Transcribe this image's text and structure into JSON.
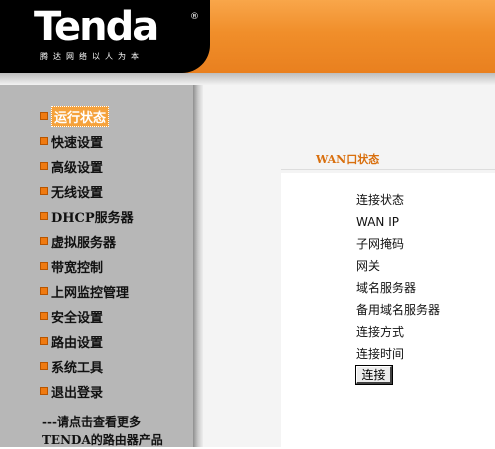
{
  "brand": {
    "logo_text": "Tenda",
    "registered_mark": "®",
    "slogan": "腾达网络以人为本"
  },
  "sidebar": {
    "items": [
      {
        "label": "运行状态",
        "active": true
      },
      {
        "label": "快速设置"
      },
      {
        "label": "高级设置"
      },
      {
        "label": "无线设置"
      },
      {
        "label": "DHCP服务器"
      },
      {
        "label": "虚拟服务器"
      },
      {
        "label": "带宽控制"
      },
      {
        "label": "上网监控管理"
      },
      {
        "label": "安全设置"
      },
      {
        "label": "路由设置"
      },
      {
        "label": "系统工具"
      },
      {
        "label": "退出登录"
      }
    ],
    "more_line1": "---请点击查看更多",
    "more_line2": "TENDA的路由器产品"
  },
  "main": {
    "section_title": "WAN口状态",
    "fields": [
      {
        "label": "连接状态"
      },
      {
        "label": "WAN IP"
      },
      {
        "label": "子网掩码"
      },
      {
        "label": "网关"
      },
      {
        "label": "域名服务器"
      },
      {
        "label": "备用域名服务器"
      },
      {
        "label": "连接方式"
      },
      {
        "label": "连接时间"
      }
    ],
    "connect_label": "连接"
  },
  "colors": {
    "header_orange": "#f08e2a",
    "sidebar_gray": "#b7b7b7",
    "accent_orange": "#f07a10",
    "title_orange": "#d96f0d"
  },
  "icons": {
    "menu_bullet": "orange-square-bullet-icon"
  }
}
